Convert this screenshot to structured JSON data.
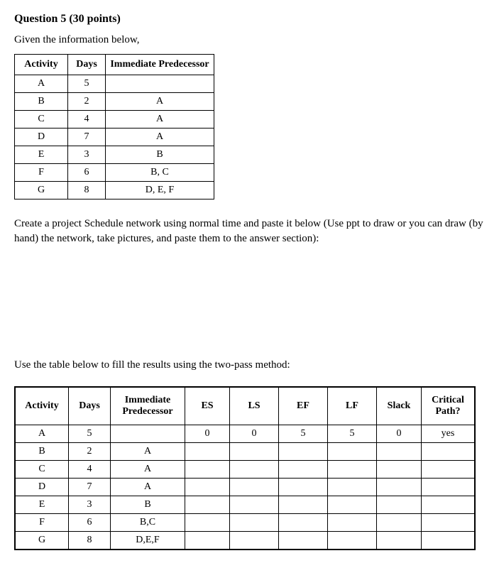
{
  "title": "Question 5 (30 points)",
  "intro": "Given the information below,",
  "table1": {
    "headers": [
      "Activity",
      "Days",
      "Immediate Predecessor"
    ],
    "rows": [
      [
        "A",
        "5",
        ""
      ],
      [
        "B",
        "2",
        "A"
      ],
      [
        "C",
        "4",
        "A"
      ],
      [
        "D",
        "7",
        "A"
      ],
      [
        "E",
        "3",
        "B"
      ],
      [
        "F",
        "6",
        "B, C"
      ],
      [
        "G",
        "8",
        "D, E, F"
      ]
    ]
  },
  "instruction1": "Create a project Schedule network using normal time and paste it below (Use ppt to draw or you can draw (by hand) the network, take pictures, and paste them to the answer section):",
  "instruction2": "Use the table below to fill the results using the two-pass method:",
  "table2": {
    "headers": [
      "Activity",
      "Days",
      "Immediate Predecessor",
      "ES",
      "LS",
      "EF",
      "LF",
      "Slack",
      "Critical Path?"
    ],
    "rows": [
      [
        "A",
        "5",
        "",
        "0",
        "0",
        "5",
        "5",
        "0",
        "yes"
      ],
      [
        "B",
        "2",
        "A",
        "",
        "",
        "",
        "",
        "",
        ""
      ],
      [
        "C",
        "4",
        "A",
        "",
        "",
        "",
        "",
        "",
        ""
      ],
      [
        "D",
        "7",
        "A",
        "",
        "",
        "",
        "",
        "",
        ""
      ],
      [
        "E",
        "3",
        "B",
        "",
        "",
        "",
        "",
        "",
        ""
      ],
      [
        "F",
        "6",
        "B,C",
        "",
        "",
        "",
        "",
        "",
        ""
      ],
      [
        "G",
        "8",
        "D,E,F",
        "",
        "",
        "",
        "",
        "",
        ""
      ]
    ]
  }
}
